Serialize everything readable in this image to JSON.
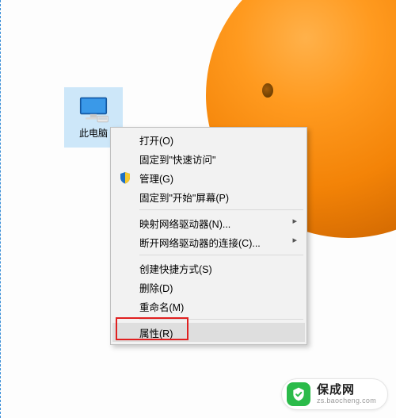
{
  "desktop": {
    "icon_label": "此电脑"
  },
  "contextMenu": {
    "items": {
      "open": "打开(O)",
      "pinQuick": "固定到\"快速访问\"",
      "manage": "管理(G)",
      "pinStart": "固定到\"开始\"屏幕(P)",
      "mapDrive": "映射网络驱动器(N)...",
      "disconnect": "断开网络驱动器的连接(C)...",
      "shortcut": "创建快捷方式(S)",
      "delete": "删除(D)",
      "rename": "重命名(M)",
      "properties": "属性(R)"
    }
  },
  "icons": {
    "shield": "shield-icon"
  },
  "watermark": {
    "name": "保成网",
    "url": "zs.baocheng.com"
  },
  "colors": {
    "selection": "#cde7f9",
    "menuBg": "#f2f2f2",
    "menuBorder": "#bfbfbf",
    "highlight": "#e02020",
    "brandGreen": "#2bbb4a"
  }
}
